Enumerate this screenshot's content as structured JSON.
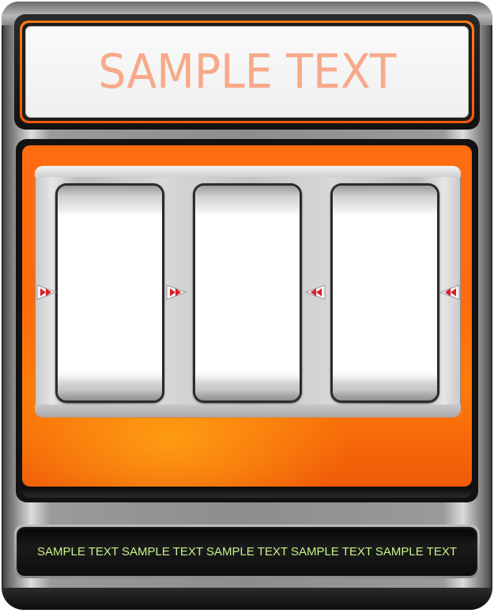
{
  "sign": {
    "title": "SAMPLE TEXT"
  },
  "reels": [
    {
      "name": "reel-left"
    },
    {
      "name": "reel-middle"
    },
    {
      "name": "reel-right"
    }
  ],
  "markers": {
    "left_outer": "right-pointing-double-arrow-icon",
    "left_inner": "right-pointing-double-arrow-icon",
    "right_inner": "left-pointing-double-arrow-icon",
    "right_outer": "left-pointing-double-arrow-icon"
  },
  "ticker": {
    "text": "SAMPLE TEXT SAMPLE TEXT SAMPLE TEXT SAMPLE TEXT SAMPLE TEXT"
  },
  "colors": {
    "accent_orange": "#ff6a0c",
    "sign_text": "#f7a98a",
    "ticker_text": "#c9f28a",
    "marker_red": "#d8202a"
  }
}
